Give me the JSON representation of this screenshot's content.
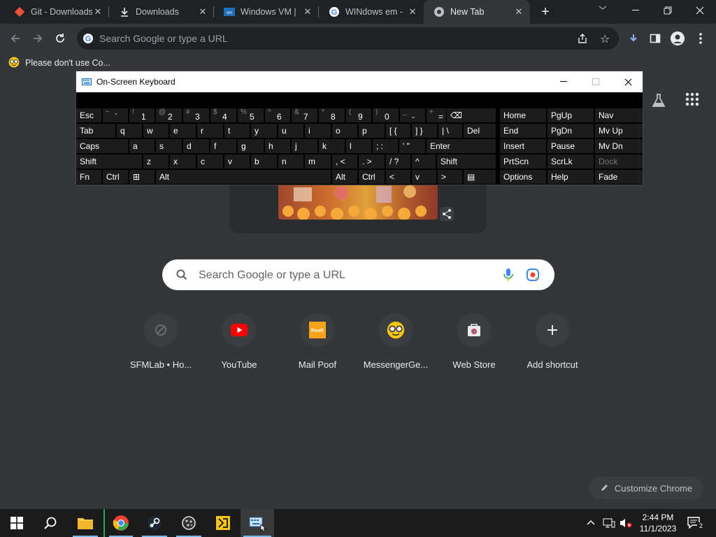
{
  "browser": {
    "tabs": [
      {
        "title": "Git - Downloads",
        "icon": "git-icon",
        "active": false
      },
      {
        "title": "Downloads",
        "icon": "download-icon",
        "active": false
      },
      {
        "title": "Windows VM |",
        "icon": "vmware-icon",
        "active": false
      },
      {
        "title": "WINdows em -",
        "icon": "google-icon",
        "active": false
      },
      {
        "title": "New Tab",
        "icon": "chrome-icon",
        "active": true
      }
    ],
    "omnibox_placeholder": "Search Google or type a URL",
    "bookmark": "Please don't use Co..."
  },
  "osk": {
    "title": "On-Screen Keyboard",
    "row1": [
      {
        "main": "Esc"
      },
      {
        "shift": "~",
        "main": "`"
      },
      {
        "shift": "!",
        "main": "1"
      },
      {
        "shift": "@",
        "main": "2"
      },
      {
        "shift": "#",
        "main": "3"
      },
      {
        "shift": "$",
        "main": "4"
      },
      {
        "shift": "%",
        "main": "5"
      },
      {
        "shift": "^",
        "main": "6"
      },
      {
        "shift": "&",
        "main": "7"
      },
      {
        "shift": "*",
        "main": "8"
      },
      {
        "shift": "(",
        "main": "9"
      },
      {
        "shift": ")",
        "main": "0"
      },
      {
        "shift": "_",
        "main": "-"
      },
      {
        "shift": "+",
        "main": "="
      },
      {
        "main": "⌫"
      }
    ],
    "row2": [
      "Tab",
      "q",
      "w",
      "e",
      "r",
      "t",
      "y",
      "u",
      "i",
      "o",
      "p",
      "[ {",
      "] }",
      "| \\",
      "Del"
    ],
    "row3": [
      "Caps",
      "a",
      "s",
      "d",
      "f",
      "g",
      "h",
      "j",
      "k",
      "l",
      "; :",
      "' \"",
      "Enter"
    ],
    "row4": [
      "Shift",
      "z",
      "x",
      "c",
      "v",
      "b",
      "n",
      "m",
      ", <",
      ". >",
      "/ ?",
      "^",
      "Shift"
    ],
    "row5": [
      "Fn",
      "Ctrl",
      "⊞",
      "Alt",
      "Alt",
      "Ctrl",
      "<",
      "v",
      ">",
      "▤"
    ],
    "nav_cols": [
      [
        "Home",
        "End",
        "Insert",
        "PrtScn",
        "Options"
      ],
      [
        "PgUp",
        "PgDn",
        "Pause",
        "ScrLk",
        "Help"
      ],
      [
        "Nav",
        "Mv Up",
        "Mv Dn",
        "Dock",
        "Fade"
      ]
    ]
  },
  "ntp": {
    "search_placeholder": "Search Google or type a URL",
    "shortcuts": [
      {
        "label": "SFMLab • Ho...",
        "icon": "sfmlab-icon"
      },
      {
        "label": "YouTube",
        "icon": "youtube-icon"
      },
      {
        "label": "Mail Poof",
        "icon": "poof-icon"
      },
      {
        "label": "MessengerGe...",
        "icon": "nerd-face-icon"
      },
      {
        "label": "Web Store",
        "icon": "webstore-icon"
      },
      {
        "label": "Add shortcut",
        "icon": "plus-icon"
      }
    ],
    "customize_label": "Customize Chrome"
  },
  "taskbar": {
    "time": "2:44 PM",
    "date": "11/1/2023",
    "notification_count": "2"
  },
  "colors": {
    "tab_strip": "#202124",
    "toolbar": "#35363a",
    "accent_blue": "#8ab4f8",
    "youtube_red": "#ff0000"
  }
}
